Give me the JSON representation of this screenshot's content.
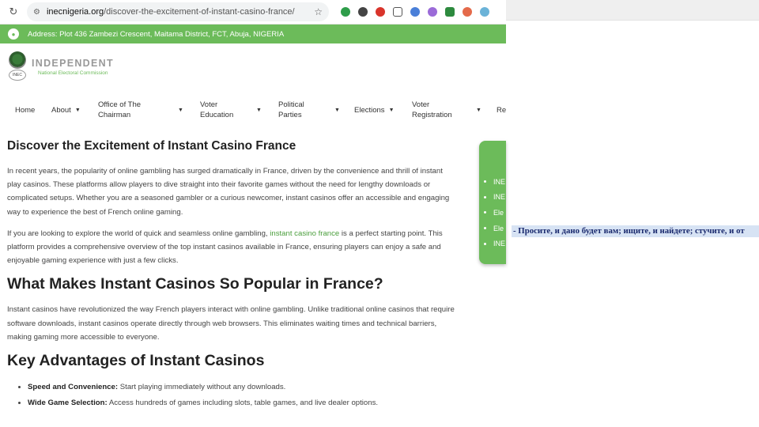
{
  "browser": {
    "url_host": "inecnigeria.org",
    "url_path": "/discover-the-excitement-of-instant-casino-france/"
  },
  "address_bar": {
    "text": "Address: Plot 436 Zambezi Crescent, Maitama District, FCT, Abuja, NIGERIA"
  },
  "logo": {
    "title": "INDEPENDENT",
    "subtitle": "National Electoral Commission",
    "seal_text": "INEC"
  },
  "nav": {
    "items": [
      {
        "label": "Home",
        "has_dropdown": false
      },
      {
        "label": "About",
        "has_dropdown": true
      },
      {
        "label": "Office of The\nChairman",
        "has_dropdown": true
      },
      {
        "label": "Voter\nEducation",
        "has_dropdown": true
      },
      {
        "label": "Political\nParties",
        "has_dropdown": true
      },
      {
        "label": "Elections",
        "has_dropdown": true
      },
      {
        "label": "Voter\nRegistration",
        "has_dropdown": true
      },
      {
        "label": "Re",
        "has_dropdown": false
      }
    ]
  },
  "article": {
    "title": "Discover the Excitement of Instant Casino France",
    "intro": "In recent years, the popularity of online gambling has surged dramatically in France, driven by the convenience and thrill of instant play casinos. These platforms allow players to dive straight into their favorite games without the need for lengthy downloads or complicated setups. Whether you are a seasoned gambler or a curious newcomer, instant casinos offer an accessible and engaging way to experience the best of French online gaming.",
    "p2_before": "If you are looking to explore the world of quick and seamless online gambling, ",
    "p2_link": "instant casino france",
    "p2_after": " is a perfect starting point. This platform provides a comprehensive overview of the top instant casinos available in France, ensuring players can enjoy a safe and enjoyable gaming experience with just a few clicks.",
    "h2_popular": "What Makes Instant Casinos So Popular in France?",
    "p_popular": "Instant casinos have revolutionized the way French players interact with online gambling. Unlike traditional online casinos that require software downloads, instant casinos operate directly through web browsers. This eliminates waiting times and technical barriers, making gaming more accessible to everyone.",
    "h2_advantages": "Key Advantages of Instant Casinos",
    "advantages": [
      {
        "label": "Speed and Convenience:",
        "text": " Start playing immediately without any downloads."
      },
      {
        "label": "Wide Game Selection:",
        "text": " Access hundreds of games including slots, table games, and live dealer options."
      }
    ]
  },
  "sidebar_widget": {
    "items": [
      "INE",
      "INE",
      "Ele",
      "Ele",
      "INE"
    ]
  },
  "overlay_text": "- Просите, и дано будет вам; ищите, и найдете; стучите, и от"
}
